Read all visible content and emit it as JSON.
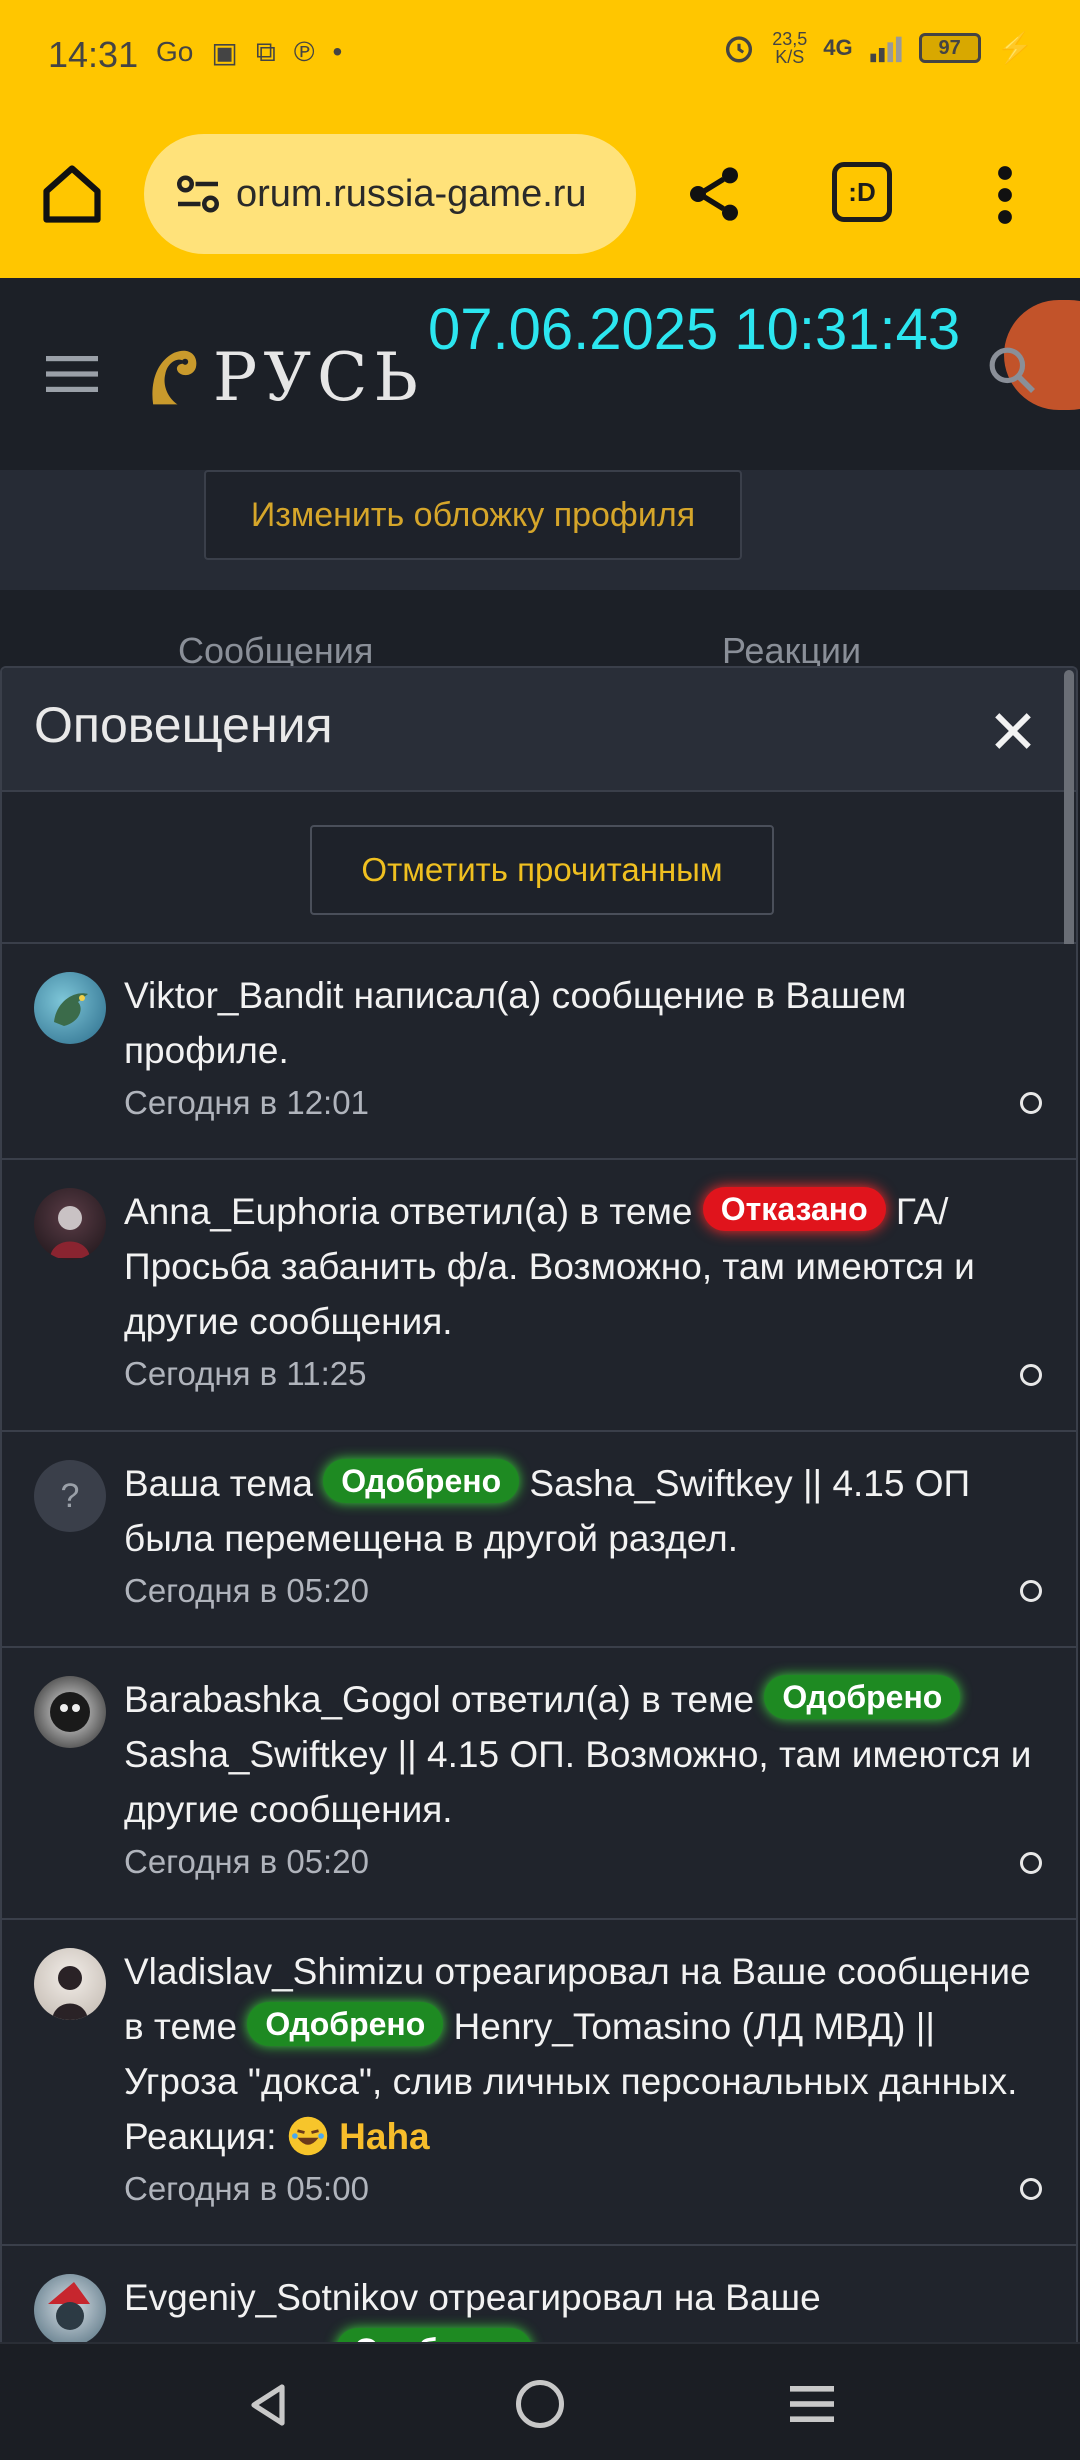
{
  "status_bar": {
    "time": "14:31",
    "net_speed_value": "23,5",
    "net_speed_unit": "K/S",
    "network": "4G",
    "battery": "97"
  },
  "browser": {
    "url": "orum.russia-game.ru",
    "tab_icon_label": ":D"
  },
  "site": {
    "logo_text": "РУСЬ",
    "timestamp_overlay": "07.06.2025 10:31:43",
    "change_cover_label": "Изменить обложку профиля",
    "tabs": [
      "Сообщения",
      "Реакции"
    ]
  },
  "panel": {
    "title": "Оповещения",
    "mark_read_label": "Отметить прочитанным",
    "notifications": [
      {
        "user": "Viktor_Bandit",
        "text": " написал(а) сообщение в Вашем профиле.",
        "time": "Сегодня в 12:01"
      },
      {
        "user": "Anna_Euphoria",
        "pre": " ответил(а) в теме ",
        "badge": "Отказано",
        "post": " ГА/ Просьба забанить ф/а. Возможно, там имеются и другие сообщения.",
        "time": "Сегодня в 11:25"
      },
      {
        "pre": "Ваша тема ",
        "badge": "Одобрено",
        "post": " Sasha_Swiftkey || 4.15 ОП была перемещена в другой раздел.",
        "time": "Сегодня в 05:20"
      },
      {
        "user": "Barabashka_Gogol",
        "pre": " ответил(а) в теме ",
        "badge": "Одобрено",
        "post": " Sasha_Swiftkey || 4.15 ОП. Возможно, там имеются и другие сообщения.",
        "time": "Сегодня в 05:20"
      },
      {
        "user": "Vladislav_Shimizu",
        "pre": " отреагировал на Ваше сообщение в теме ",
        "badge": "Одобрено",
        "post": " Henry_Tomasino (ЛД МВД) || Угроза \"докса\", слив личных персональных данных. Реакция: ",
        "reaction": "Haha",
        "time": "Сегодня в 05:00"
      },
      {
        "user": "Evgeniy_Sotnikov",
        "pre": " отреагировал на Ваше",
        "badge": "Одобрено"
      }
    ]
  },
  "colors": {
    "browser_yellow": "#ffc600",
    "accent_gold": "#f0c020",
    "badge_red": "#e0141c",
    "badge_green": "#1e8a22",
    "timestamp_cyan": "#2ce6f0"
  },
  "icons": [
    "home-icon",
    "site-settings-icon",
    "share-icon",
    "tab-switcher-icon",
    "more-vert-icon",
    "menu-icon",
    "search-icon",
    "close-icon",
    "unread-dot-icon",
    "back-icon",
    "nav-home-icon",
    "recents-icon"
  ]
}
